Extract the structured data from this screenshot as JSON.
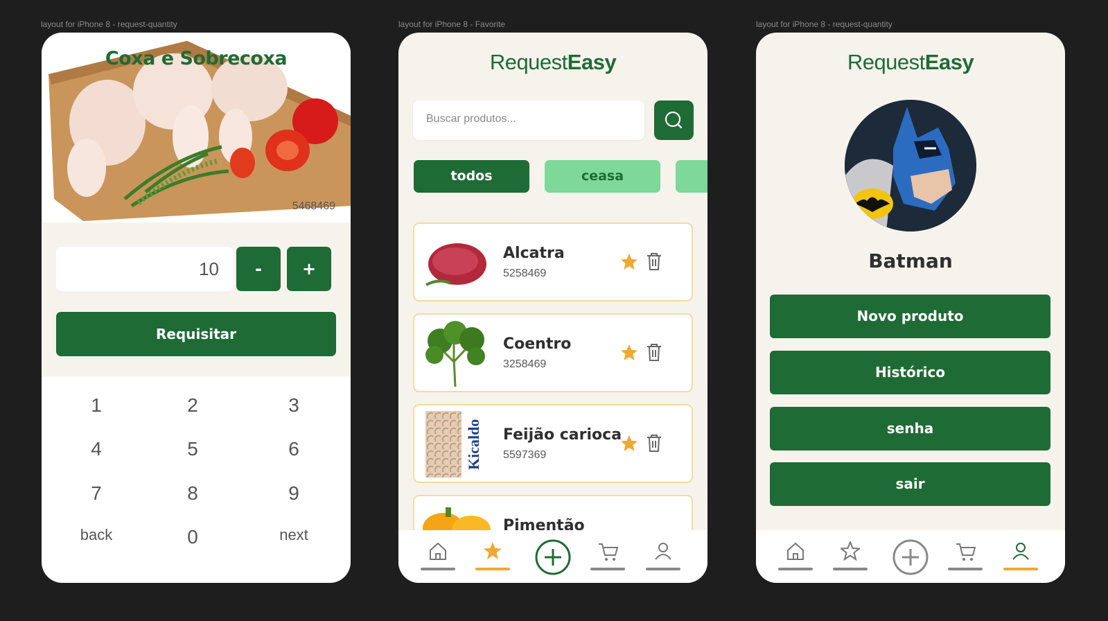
{
  "frames": [
    {
      "label": "layout for iPhone 8 - request-quantity"
    },
    {
      "label": "layout for iPhone 8 - Favorite"
    },
    {
      "label": "layout for iPhone 8 - request-quantity"
    }
  ],
  "request": {
    "title": "Coxa e Sobrecoxa",
    "code": "5468469",
    "quantity": "10",
    "minus_label": "-",
    "plus_label": "+",
    "submit_label": "Requisitar",
    "keypad": [
      "1",
      "2",
      "3",
      "4",
      "5",
      "6",
      "7",
      "8",
      "9",
      "back",
      "0",
      "next"
    ]
  },
  "brand": {
    "part1": "Request",
    "part2": "Easy"
  },
  "favorites": {
    "search_placeholder": "Buscar produtos...",
    "chips": [
      "todos",
      "ceasa",
      ""
    ],
    "products": [
      {
        "name": "Alcatra",
        "code": "5258469",
        "favorite": true
      },
      {
        "name": "Coentro",
        "code": "3258469",
        "favorite": true
      },
      {
        "name": "Feijão carioca",
        "code": "5597369",
        "favorite": true
      },
      {
        "name": "Pimentão",
        "code": "",
        "favorite": true
      }
    ],
    "product_image_text": "Kicaldo",
    "active_tab": "favorites"
  },
  "profile": {
    "user_name": "Batman",
    "menu": [
      "Novo produto",
      "Histórico",
      "senha",
      "sair"
    ],
    "active_tab": "profile"
  },
  "tabs": [
    "home",
    "favorites",
    "add",
    "cart",
    "profile"
  ],
  "colors": {
    "primary_green": "#1f6b35",
    "light_green": "#7dd89a",
    "accent_orange": "#f0a830",
    "background": "#f6f3ed"
  }
}
